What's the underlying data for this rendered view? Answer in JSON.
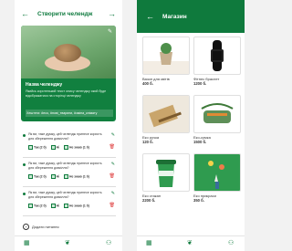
{
  "left_screen": {
    "title": "Створити челендж",
    "card": {
      "title": "Назва челенджу",
      "description": "Якийсь коротенький текст опису челенджу який буде відображатися на сторінці челенджу",
      "tags": "Хештеги: #eco, #нові_тварини, #зміна_клімату"
    },
    "questions": [
      {
        "text": "Як ви, таке думку, цей челендж принесе користь для збереження довкілля?",
        "opt1": "Так (2 б)",
        "opt2": "Ні",
        "opt3": "Не знаю (1 б)"
      },
      {
        "text": "Як ви, таке думку, цей челендж принесе користь для збереження довкілля?",
        "opt1": "Так (2 б)",
        "opt2": "Ні",
        "opt3": "Не знаю (1 б)"
      },
      {
        "text": "Як ви, таке думку, цей челендж принесе користь для збереження довкілля?",
        "opt1": "Так (2 б)",
        "opt2": "Ні",
        "opt3": "Не знаю (1 б)"
      }
    ],
    "add_question": "Додати питання"
  },
  "right_screen": {
    "title": "Магазин",
    "items": [
      {
        "name": "Вазон для квітів",
        "price": "400 б."
      },
      {
        "name": "Фітнес браслет",
        "price": "1200 б."
      },
      {
        "name": "Еко ручка",
        "price": "120 б."
      },
      {
        "name": "Еко-сумка",
        "price": "1500 б."
      },
      {
        "name": "Еко стакан",
        "price": "2200 б."
      },
      {
        "name": "Еко прикраси",
        "price": "350 б."
      }
    ]
  },
  "icons": {
    "back": "arrow-left-icon",
    "forward": "arrow-right-icon",
    "edit": "pencil-icon",
    "delete": "trash-icon",
    "nav": [
      "grid-icon",
      "leaf-icon",
      "people-icon"
    ]
  },
  "colors": {
    "brand": "#0f7a3d",
    "danger": "#d33"
  }
}
